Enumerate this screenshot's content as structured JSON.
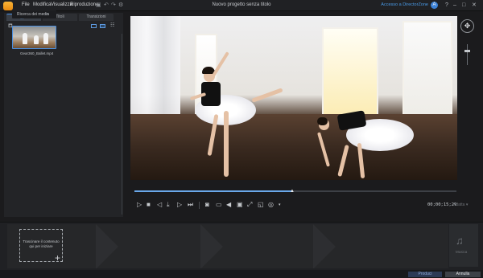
{
  "titlebar": {
    "menu": [
      "File",
      "Modifica",
      "Visualizza",
      "Riproduzione"
    ],
    "window_title": "Nuovo progetto senza titolo",
    "login_link": "Accesso a DirectorZone",
    "user_initial": "A"
  },
  "left_panel": {
    "tabs": [
      "Supporto",
      "Titoli",
      "Transizioni"
    ],
    "search_placeholder": "Ricerca dei media",
    "media_items": [
      {
        "name": "Gear360_Ballet.mp4"
      }
    ]
  },
  "playback": {
    "progress_fraction": 0.49,
    "timecode": "00;00;15;29",
    "quality_label": "Adatta ▾"
  },
  "workspace": {
    "drop_hint": "Trascinare il contenuto qui per iniziare",
    "music_label": "Musica"
  },
  "footer": {
    "produce_label": "Produci",
    "cancel_label": "Annulla"
  },
  "colors": {
    "accent": "#4a90e2",
    "app_logo": "#f5a623",
    "background": "#1b1b1d"
  }
}
